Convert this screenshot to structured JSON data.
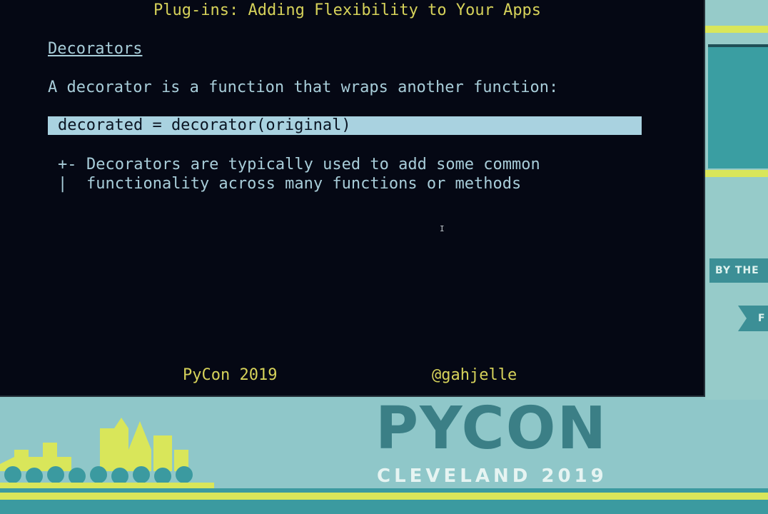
{
  "slide": {
    "title": "Plug-ins: Adding Flexibility to Your Apps",
    "section_heading": "Decorators",
    "intro": "A decorator is a function that wraps another function:",
    "code": "decorated = decorator(original)",
    "bullet_marker": "+-",
    "bullet_pipe": "|",
    "bullet_lines": [
      "Decorators are typically used to add some common",
      "functionality across many functions or methods"
    ],
    "cursor_glyph": "I",
    "footer_left": "PyCon 2019",
    "footer_right": "@gahjelle"
  },
  "conference": {
    "wordmark": "PYCON",
    "subtitle": "CLEVELAND 2019",
    "banner_text": "BY THE",
    "banner_tab_text": "F"
  },
  "colors": {
    "terminal_bg": "#050814",
    "text": "#a8cdd9",
    "accent_yellow": "#d6d25a",
    "code_highlight": "#a9d2e0",
    "frame_teal": "#8fc7c9",
    "lime": "#d9e65a"
  }
}
